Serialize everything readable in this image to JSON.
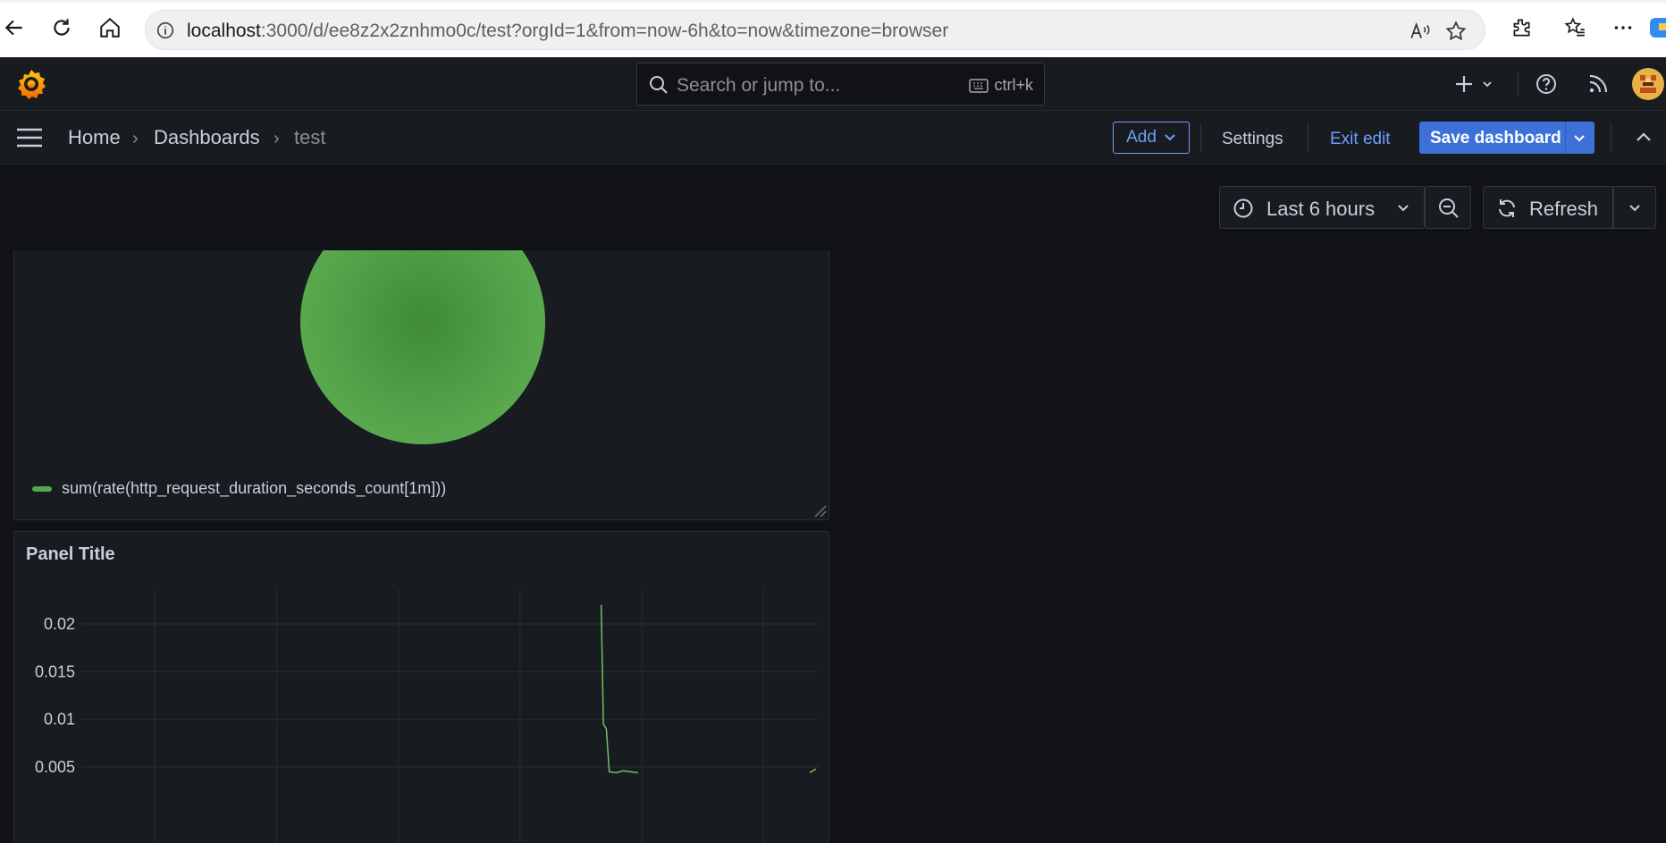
{
  "browser": {
    "url_host": "localhost",
    "url_rest": ":3000/d/ee8z2x2znhmo0c/test?orgId=1&from=now-6h&to=now&timezone=browser"
  },
  "topnav": {
    "search_placeholder": "Search or jump to...",
    "search_shortcut": "ctrl+k"
  },
  "breadcrumb": {
    "items": [
      "Home",
      "Dashboards",
      "test"
    ]
  },
  "toolbar": {
    "add_label": "Add",
    "settings_label": "Settings",
    "exit_edit_label": "Exit edit",
    "save_label": "Save dashboard"
  },
  "controls": {
    "time_range": "Last 6 hours",
    "refresh_label": "Refresh"
  },
  "pie_panel": {
    "legend_label": "sum(rate(http_request_duration_seconds_count[1m]))",
    "series_color": "#56a64b"
  },
  "ts_panel": {
    "title": "Panel Title"
  },
  "chart_data": [
    {
      "type": "pie",
      "series": [
        {
          "name": "sum(rate(http_request_duration_seconds_count[1m]))",
          "values": [
            1
          ]
        }
      ],
      "colors": [
        "#56a64b"
      ],
      "legend": "bottom-left"
    },
    {
      "type": "line",
      "title": "Panel Title",
      "y_ticks": [
        "0.02",
        "0.015",
        "0.01",
        "0.005"
      ],
      "ylim": [
        0,
        0.025
      ],
      "grid": true,
      "series": [
        {
          "color": "#73bf69",
          "points": [
            [
              0.705,
              0.022
            ],
            [
              0.708,
              0.0095
            ],
            [
              0.712,
              0.009
            ],
            [
              0.716,
              0.0045
            ],
            [
              0.725,
              0.0044
            ],
            [
              0.735,
              0.0046
            ],
            [
              0.745,
              0.0045
            ],
            [
              0.755,
              0.0044
            ]
          ]
        },
        {
          "color": "#73bf69",
          "points": [
            [
              0.988,
              0.0044
            ],
            [
              0.996,
              0.0048
            ]
          ]
        }
      ]
    }
  ],
  "colors": {
    "accent_blue": "#3d71d9",
    "link_blue": "#6e9fff",
    "grafana_orange": "#f46800"
  }
}
